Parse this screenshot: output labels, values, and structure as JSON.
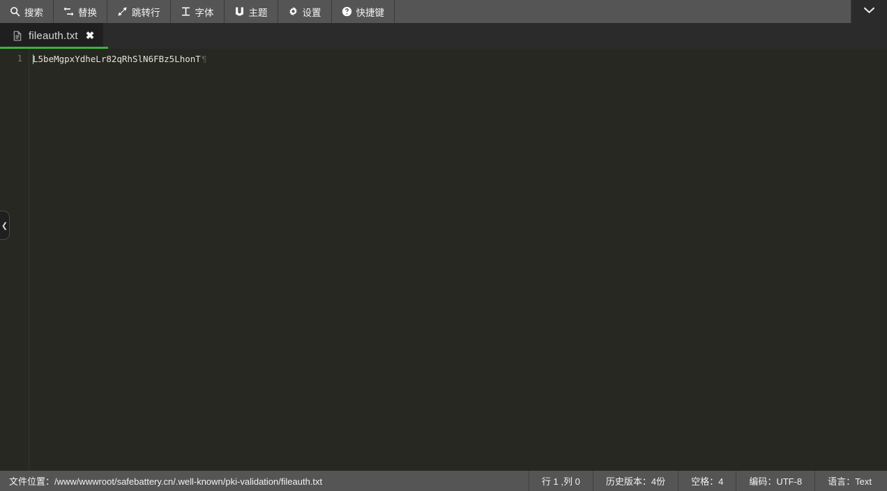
{
  "toolbar": {
    "buttons": [
      {
        "label": "搜索",
        "icon": "search-icon",
        "name": "search"
      },
      {
        "label": "替换",
        "icon": "exchange-icon",
        "name": "replace"
      },
      {
        "label": "跳转行",
        "icon": "goto-line-icon",
        "name": "goto-line"
      },
      {
        "label": "字体",
        "icon": "font-icon",
        "name": "font"
      },
      {
        "label": "主题",
        "icon": "magnet-icon",
        "name": "theme"
      },
      {
        "label": "设置",
        "icon": "gear-icon",
        "name": "settings"
      },
      {
        "label": "快捷键",
        "icon": "question-circle-icon",
        "name": "shortcuts"
      }
    ],
    "more_icon": "chevron-down-icon"
  },
  "tabs": {
    "items": [
      {
        "label": "fileauth.txt",
        "icon": "file-icon",
        "close_glyph": "✖",
        "active": true
      }
    ],
    "accent_color": "#3cb23c"
  },
  "editor": {
    "lines": [
      {
        "number": "1",
        "text": "L5beMgpxYdheLr82qRhSlN6FBz5LhonT",
        "eol_glyph": "¶"
      }
    ],
    "collapse_handle_glyph": "❮",
    "background_color": "#272821"
  },
  "statusbar": {
    "file_location": "文件位置：/www/wwwroot/safebattery.cn/.well-known/pki-validation/fileauth.txt",
    "items": [
      {
        "label": "行 1 ,列 0",
        "name": "cursor-position"
      },
      {
        "label": "历史版本：4份",
        "name": "history-versions"
      },
      {
        "label": "空格：4",
        "name": "indent-size"
      },
      {
        "label": "编码：UTF-8",
        "name": "encoding"
      },
      {
        "label": "语言：Text",
        "name": "language"
      }
    ]
  }
}
